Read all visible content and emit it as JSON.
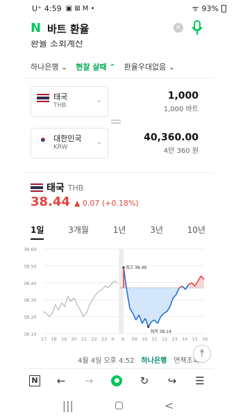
{
  "status": {
    "carrier": "U⁺",
    "time": "4:59",
    "battery": "93%"
  },
  "search": {
    "query": "바트 환율"
  },
  "top_tabs": {
    "bank": "하나은행",
    "type": "현찰 살때",
    "fee": "환율우대없음"
  },
  "from_currency": {
    "name": "태국",
    "code": "THB",
    "amount": "1,000",
    "amount_words": "1,000 바트"
  },
  "to_currency": {
    "name": "대한민국",
    "code": "KRW",
    "amount": "40,360.00",
    "amount_words": "4만 360 원"
  },
  "rate": {
    "name": "태국",
    "code": "THB",
    "value": "38.44",
    "change": "0.07 (+0.18%)"
  },
  "periods": [
    "1일",
    "3개월",
    "1년",
    "3년",
    "10년"
  ],
  "chart_data": {
    "type": "line",
    "yticks": [
      "38.60",
      "38.50",
      "38.40",
      "38.30",
      "38.20",
      "38.10"
    ],
    "xticks": [
      "17",
      "18",
      "19",
      "20",
      "21",
      "22",
      "23",
      "0",
      "6",
      "09",
      "10",
      "11",
      "12",
      "13",
      "14",
      "15",
      "16"
    ],
    "ylim": [
      38.1,
      38.6
    ],
    "baseline": 38.37,
    "high_label": "최고 38.49",
    "low_label": "최저 38.14",
    "prev_x": [
      0,
      1,
      2,
      3,
      4,
      5,
      6,
      7,
      8,
      9,
      10,
      11,
      12,
      13,
      14,
      15,
      16,
      17,
      18,
      19,
      20,
      21,
      22,
      23,
      24
    ],
    "prev_y": [
      38.23,
      38.22,
      38.2,
      38.22,
      38.27,
      38.24,
      38.28,
      38.26,
      38.32,
      38.29,
      38.31,
      38.27,
      38.24,
      38.2,
      38.22,
      38.27,
      38.3,
      38.33,
      38.35,
      38.36,
      38.38,
      38.37,
      38.39,
      38.41,
      38.4
    ],
    "today_x": [
      26,
      27,
      28,
      29,
      30,
      31,
      32,
      33,
      34,
      35,
      36,
      37,
      38,
      39,
      40,
      41,
      42,
      43,
      44,
      45,
      46,
      47,
      48,
      49,
      50,
      51,
      52
    ],
    "today_y": [
      38.49,
      38.36,
      38.25,
      38.22,
      38.18,
      38.21,
      38.16,
      38.19,
      38.14,
      38.17,
      38.18,
      38.16,
      38.2,
      38.22,
      38.23,
      38.26,
      38.31,
      38.33,
      38.37,
      38.38,
      38.36,
      38.39,
      38.4,
      38.38,
      38.41,
      38.44,
      38.42
    ]
  },
  "footer": {
    "date": "4월 4일 오후 4:52",
    "source": "하나은행",
    "note": "연책조회"
  }
}
